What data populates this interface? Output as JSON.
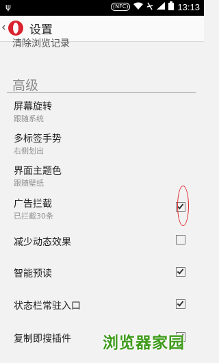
{
  "status_bar": {
    "left_icon": "usb-icon",
    "nfc_label": "(NFC)",
    "time": "13:13",
    "icons": [
      "wifi-icon",
      "no-sim-icon",
      "signal-icon",
      "battery-icon"
    ]
  },
  "app_bar": {
    "back_icon": "chevron-left-icon",
    "logo_icon": "opera-logo-icon",
    "title": "设置"
  },
  "partial_row": {
    "label": "清除浏览记录"
  },
  "section": {
    "header": "高级"
  },
  "settings": [
    {
      "label": "屏幕旋转",
      "sub": "跟随系统"
    },
    {
      "label": "多标签手势",
      "sub": "右侧划出"
    },
    {
      "label": "界面主题色",
      "sub": "跟随壁纸"
    },
    {
      "label": "广告拦截",
      "sub": "已拦截30条",
      "checked": true
    },
    {
      "label": "减少动态效果",
      "checked": false
    },
    {
      "label": "智能预读",
      "checked": true
    },
    {
      "label": "状态栏常驻入口",
      "checked": true
    },
    {
      "label": "复制即搜插件",
      "checked": true
    }
  ],
  "colors": {
    "annotation": "#e0242a",
    "watermark": "#3f9b1c",
    "logo": "#d9232e"
  },
  "watermark": {
    "text": "浏览器家园"
  }
}
